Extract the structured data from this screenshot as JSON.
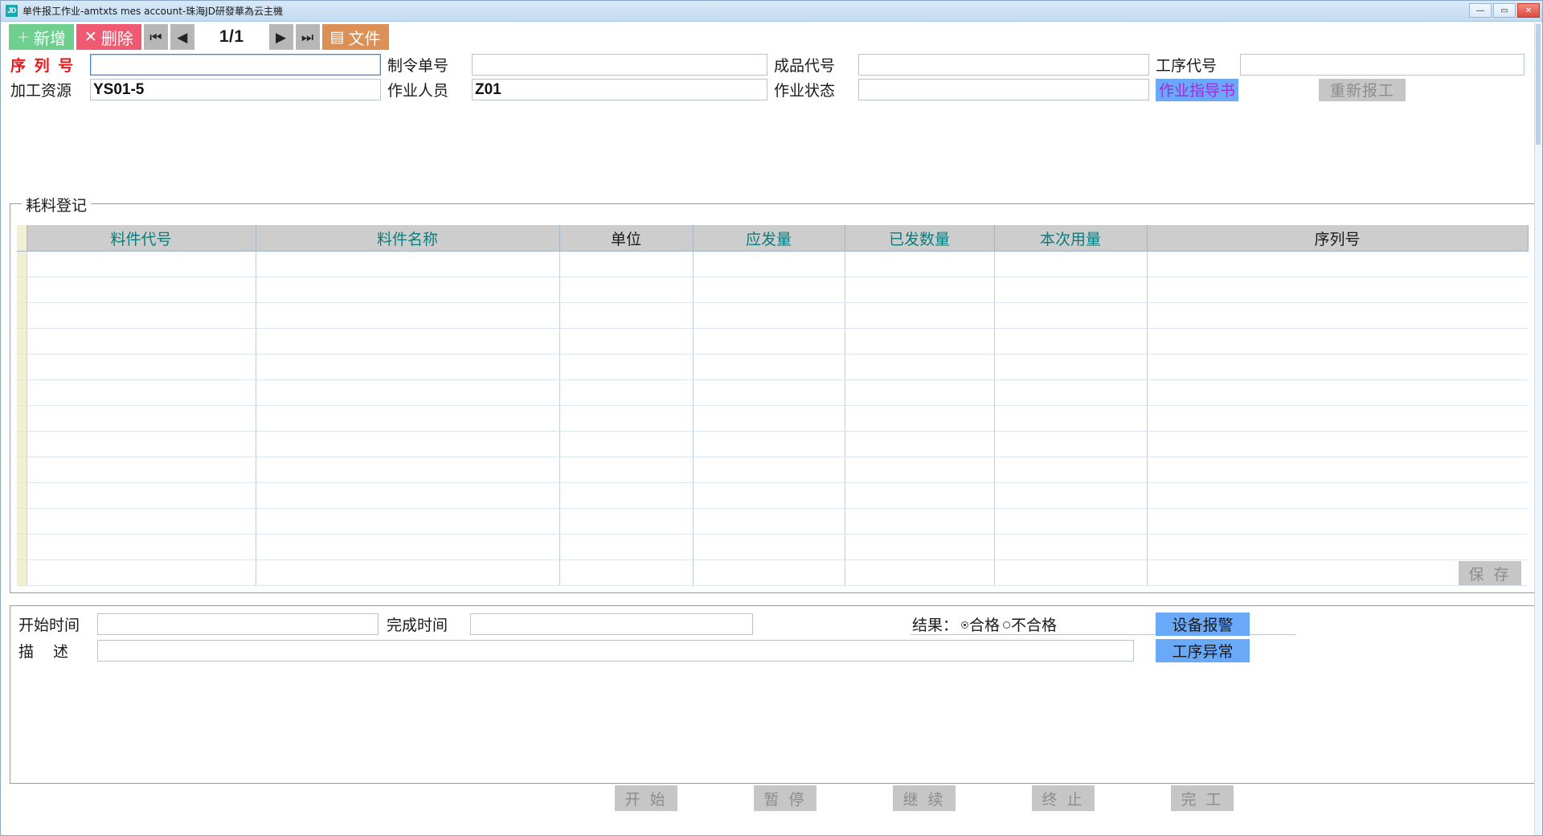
{
  "window": {
    "logo_text": "JD",
    "title": "单件报工作业-amtxts mes account-珠海JD研發華為云主機",
    "controls": {
      "minimize": "—",
      "maximize": "▭",
      "close": "✕"
    }
  },
  "toolbar": {
    "add_glyph": "+",
    "add_label": "新增",
    "delete_glyph": "✕",
    "delete_label": "删除",
    "first_icon": "⏮",
    "prev_icon": "◀",
    "page_indicator": "1/1",
    "next_icon": "▶",
    "last_icon": "⏭",
    "file_glyph": "▤",
    "file_label": "文件"
  },
  "form": {
    "serial_label": "序 列 号",
    "serial_value": "",
    "order_label": "制令单号",
    "order_value": "",
    "product_label": "成品代号",
    "product_value": "",
    "process_label": "工序代号",
    "process_value": "",
    "resource_label": "加工资源",
    "resource_value": "YS01-5",
    "operator_label": "作业人员",
    "operator_value": "Z01",
    "status_label": "作业状态",
    "status_value": "",
    "guide_button": "作业指导书",
    "rework_button": "重新报工"
  },
  "consume": {
    "legend": "耗料登记",
    "columns": [
      "料件代号",
      "料件名称",
      "单位",
      "应发量",
      "已发数量",
      "本次用量",
      "序列号"
    ],
    "rows": [],
    "row_count": 13,
    "save_button": "保 存"
  },
  "bottom": {
    "start_time_label": "开始时间",
    "start_time_value": "",
    "end_time_label": "完成时间",
    "end_time_value": "",
    "result_label": "结果：",
    "result_pass": "合格",
    "result_fail": "不合格",
    "result_selected": "合格",
    "desc_label": "描    述",
    "desc_value": "",
    "alarm_equipment": "设备报警",
    "alarm_process": "工序异常"
  },
  "footer": {
    "start": "开 始",
    "pause": "暂 停",
    "resume": "继 续",
    "stop": "终 止",
    "finish": "完 工"
  },
  "colors": {
    "add": "#6ecf8e",
    "delete": "#ef5972",
    "file": "#dd9055",
    "accent_blue": "#6aa9f7",
    "guide_text": "#a42ae0",
    "required": "#e8191b",
    "header_teal": "#0b7b7b",
    "disabled": "#c6c6c6"
  }
}
